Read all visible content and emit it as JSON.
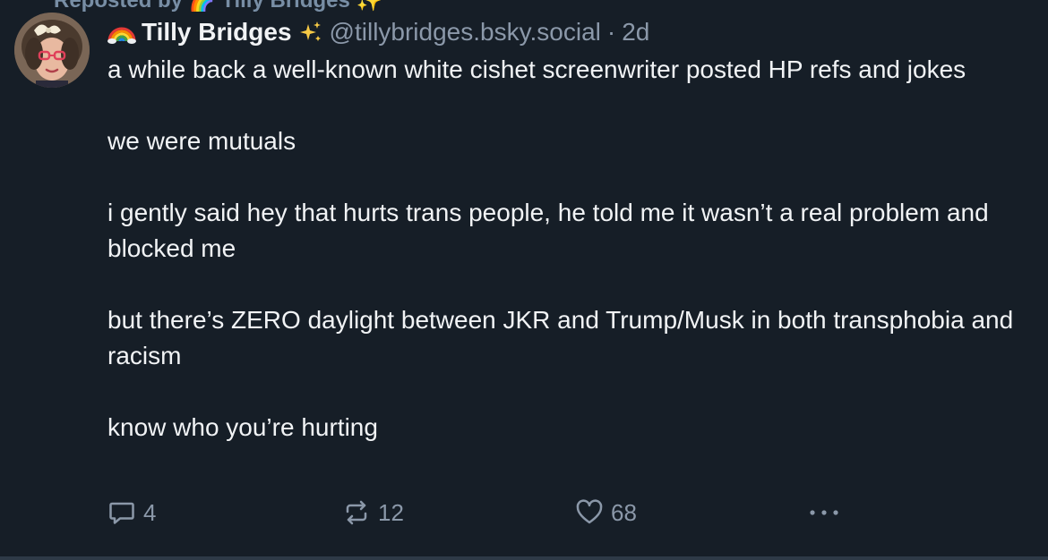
{
  "repost": {
    "label": "Reposted by 🌈 Tilly Bridges ✨"
  },
  "author": {
    "display_name": "Tilly Bridges",
    "handle": "@tillybridges.bsky.social",
    "separator": "·",
    "time": "2d",
    "name_prefix_icon": "rainbow-icon",
    "name_suffix_icon": "sparkles-icon"
  },
  "post": {
    "paragraphs": [
      "a while back a well-known white cishet screenwriter posted HP refs and jokes",
      "we were mutuals",
      "i gently said hey that hurts trans people, he told me it wasn’t a real problem and blocked me",
      "but there’s ZERO daylight between JKR and Trump/Musk in both transphobia and racism",
      "know who you’re hurting"
    ]
  },
  "actions": {
    "replies": "4",
    "reposts": "12",
    "likes": "68",
    "more_icon": "more-horizontal-icon"
  },
  "colors": {
    "background": "#161e27",
    "text": "#f1f3f5",
    "muted": "#8b98a9"
  }
}
